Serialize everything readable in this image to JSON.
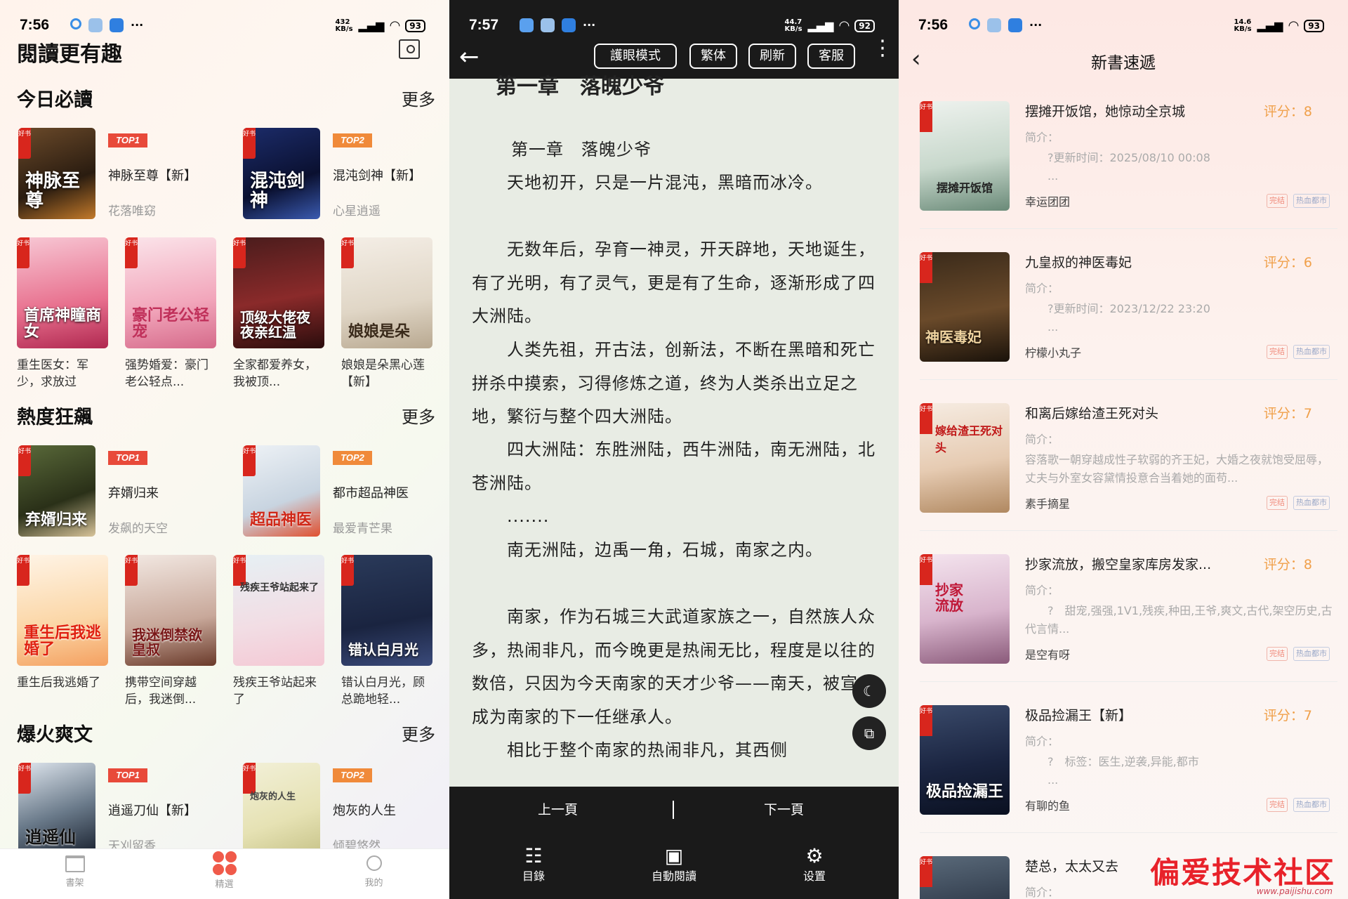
{
  "panel1": {
    "status": {
      "time": "7:56",
      "speed": "432\nKB/s",
      "net": "HD",
      "battery": "93"
    },
    "header": {
      "title": "閱讀更有趣"
    },
    "sections": [
      {
        "title": "今日必讀",
        "more": "更多",
        "top": [
          {
            "badge": "TOP1",
            "title": "神脉至尊【新】",
            "author": "花落唯窈",
            "cover_text": "神脉至尊"
          },
          {
            "badge": "TOP2",
            "title": "混沌剑神【新】",
            "author": "心星逍遥",
            "cover_text": "混沌剑神"
          }
        ],
        "grid": [
          {
            "title": "重生医女：军少，求放过",
            "cover_text": "首席神瞳商女"
          },
          {
            "title": "强势婚爱：豪门老公轻点...",
            "cover_text": "豪门老公轻宠"
          },
          {
            "title": "全家都爱养女，我被顶...",
            "cover_text": "顶级大佬夜夜亲红温"
          },
          {
            "title": "娘娘是朵黑心莲【新】",
            "cover_text": "娘娘是朵"
          }
        ]
      },
      {
        "title": "熱度狂飆",
        "more": "更多",
        "top": [
          {
            "badge": "TOP1",
            "title": "弃婿归来",
            "author": "发飙的天空",
            "cover_text": "弃婿归来"
          },
          {
            "badge": "TOP2",
            "title": "都市超品神医",
            "author": "最爱青芒果",
            "cover_text": "超品神医"
          }
        ],
        "grid": [
          {
            "title": "重生后我逃婚了",
            "cover_text": "重生后我逃婚了"
          },
          {
            "title": "携带空间穿越后，我迷倒...",
            "cover_text": "我迷倒禁欲皇叔"
          },
          {
            "title": "残疾王爷站起来了",
            "cover_text": "残疾王爷站起来了"
          },
          {
            "title": "错认白月光，顾总跪地轻...",
            "cover_text": "错认白月光"
          }
        ]
      },
      {
        "title": "爆火爽文",
        "more": "更多",
        "top": [
          {
            "badge": "TOP1",
            "title": "逍遥刀仙【新】",
            "author": "天刈留香",
            "cover_text": "逍遥仙"
          },
          {
            "badge": "TOP2",
            "title": "炮灰的人生",
            "author": "倾碧悠然",
            "cover_text": "炮灰的人生"
          }
        ]
      }
    ],
    "tabs": [
      {
        "label": "書架"
      },
      {
        "label": "精選"
      },
      {
        "label": "我的"
      }
    ],
    "cover_tag": "好书"
  },
  "panel2": {
    "status": {
      "time": "7:57",
      "speed": "44.7\nKB/s",
      "battery": "92"
    },
    "buttons": {
      "eye_mode": "護眼模式",
      "trad": "繁体",
      "refresh": "刷新",
      "service": "客服"
    },
    "chapter_head": "第一章　落魄少爷",
    "paragraphs": [
      "第一章　落魄少爷",
      "　　天地初开，只是一片混沌，黑暗而冰冷。",
      "　　无数年后，孕育一神灵，开天辟地，天地诞生，有了光明，有了灵气，更是有了生命，逐渐形成了四大洲陆。",
      "　　人类先祖，开古法，创新法，不断在黑暗和死亡拼杀中摸索，习得修炼之道，终为人类杀出立足之地，繁衍与整个四大洲陆。",
      "　　四大洲陆：东胜洲陆，西牛洲陆，南无洲陆，北苍洲陆。",
      "　　.......",
      "　　南无洲陆，边禹一角，石城，南家之内。",
      "　　南家，作为石城三大武道家族之一，自然族人众多，热闹非凡，而今晚更是热闹无比，程度是以往的数倍，只因为今天南家的天才少爷——南天，被宣布成为南家的下一任继承人。",
      "　　相比于整个南家的热闹非凡，其西侧"
    ],
    "nav": {
      "prev": "上一頁",
      "next": "下一頁"
    },
    "bottom": [
      {
        "label": "目錄"
      },
      {
        "label": "自動閱讀"
      },
      {
        "label": "设置"
      }
    ]
  },
  "panel3": {
    "status": {
      "time": "7:56",
      "speed": "14.6\nKB/s",
      "battery": "93"
    },
    "header": {
      "title": "新書速遞"
    },
    "books": [
      {
        "title": "摆摊开饭馆，她惊动全京城",
        "score": "评分：8",
        "intro_label": "简介：",
        "desc": "　　?更新时间：2025/08/10 00:08\n　　...",
        "author": "幸运团团",
        "tag1": "完结",
        "tag2": "热血都市",
        "cover_text": "摆摊开饭馆"
      },
      {
        "title": "九皇叔的神医毒妃",
        "score": "评分：6",
        "intro_label": "简介：",
        "desc": "　　?更新时间：2023/12/22 23:20\n　　...",
        "author": "柠檬小丸子",
        "tag1": "完结",
        "tag2": "热血都市",
        "cover_text": "神医毒妃"
      },
      {
        "title": "和离后嫁给渣王死对头",
        "score": "评分：7",
        "intro_label": "简介：",
        "desc": "容落歌一朝穿越成性子软弱的齐王妃，大婚之夜就饱受屈辱，丈夫与外室女容黛情投意合当着她的面苟...",
        "author": "素手摘星",
        "tag1": "完结",
        "tag2": "热血都市",
        "cover_text": "嫁给渣王死对头"
      },
      {
        "title": "抄家流放，搬空皇家库房发家...",
        "score": "评分：8",
        "intro_label": "简介：",
        "desc": "　　?　甜宠,强强,1V1,残疾,种田,王爷,爽文,古代,架空历史,古代言情...",
        "author": "是空有呀",
        "tag1": "完结",
        "tag2": "热血都市",
        "cover_text": "抄家流放"
      },
      {
        "title": "极品捡漏王【新】",
        "score": "评分：7",
        "intro_label": "简介：",
        "desc": "　　?　标签：医生,逆袭,异能,都市\n　　...",
        "author": "有聊的鱼",
        "tag1": "完结",
        "tag2": "热血都市",
        "cover_text": "极品捡漏王"
      },
      {
        "title": "楚总，太太又去",
        "score": "",
        "intro_label": "简介：",
        "desc": "",
        "author": "",
        "tag1": "",
        "tag2": "",
        "cover_text": ""
      }
    ],
    "watermark": "偏爱技术社区",
    "watermark_url": "www.paijishu.com"
  }
}
